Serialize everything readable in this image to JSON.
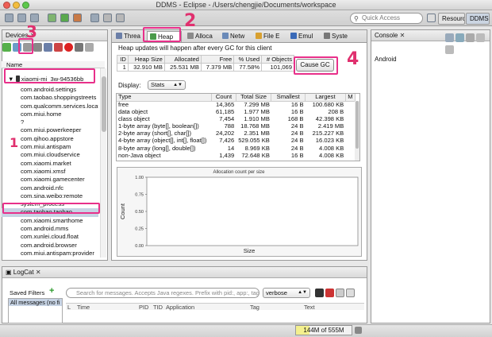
{
  "window": {
    "title": "DDMS - Eclipse - /Users/chengjie/Documents/workspace"
  },
  "toolbar": {
    "quick_access_placeholder": "Quick Access",
    "perspective_resource": "Resource",
    "perspective_ddms": "DDMS"
  },
  "devices": {
    "title": "Devices",
    "name_header": "Name",
    "device": "xiaomi-mi_3w-94536bb",
    "processes": [
      "com.android.settings",
      "com.taobao.shoppingstreets",
      "com.qualcomm.services.locat",
      "com.miui.home",
      "?",
      "com.miui.powerkeeper",
      "com.qihoo.appstore",
      "com.miui.antispam",
      "com.miui.cloudservice",
      "com.xiaomi.market",
      "com.xiaomi.xmsf",
      "com.xiaomi.gamecenter",
      "com.android.nfc",
      "com.sina.weibo:remote",
      "system_process",
      "com.taobao.taobao",
      "com.xiaomi.smarthome",
      "com.android.mms",
      "com.xunlei.cloud.float",
      "com.android.browser",
      "com.miui.antispam:provider"
    ],
    "selected_index": 15
  },
  "tabs": [
    "Threa",
    "Heap",
    "Alloca",
    "Netw",
    "File E",
    "Emul",
    "Syste"
  ],
  "heap": {
    "message": "Heap updates will happen after every GC for this client",
    "summary_headers": [
      "ID",
      "Heap Size",
      "Allocated",
      "Free",
      "% Used",
      "# Objects"
    ],
    "summary_row": [
      "1",
      "32.910 MB",
      "25.531 MB",
      "7.379 MB",
      "77.58%",
      "101,069"
    ],
    "cause_gc": "Cause GC",
    "display_label": "Display:",
    "display_value": "Stats",
    "stats_headers": [
      "Type",
      "Count",
      "Total Size",
      "Smallest",
      "Largest",
      "M"
    ],
    "stats_rows": [
      [
        "free",
        "14,365",
        "7.299 MB",
        "16 B",
        "100.680 KB"
      ],
      [
        "data object",
        "61,185",
        "1.977 MB",
        "16 B",
        "208 B"
      ],
      [
        "class object",
        "7,454",
        "1.910 MB",
        "168 B",
        "42.398 KB"
      ],
      [
        "1-byte array (byte[], boolean[])",
        "788",
        "18.768 MB",
        "24 B",
        "2.419 MB"
      ],
      [
        "2-byte array (short[], char[])",
        "24,202",
        "2.351 MB",
        "24 B",
        "215.227 KB"
      ],
      [
        "4-byte array (object[], int[], float[])",
        "7,426",
        "529.055 KB",
        "24 B",
        "16.023 KB"
      ],
      [
        "8-byte array (long[], double[])",
        "14",
        "8.969 KB",
        "24 B",
        "4.008 KB"
      ],
      [
        "non-Java object",
        "1,439",
        "72.648 KB",
        "16 B",
        "4.008 KB"
      ]
    ]
  },
  "chart_data": {
    "type": "bar",
    "title": "Allocation count per size",
    "xlabel": "Size",
    "ylabel": "Count",
    "ylim": [
      0,
      1.0
    ],
    "yticks": [
      "0.00",
      "0.25",
      "0.50",
      "0.75",
      "1.00"
    ],
    "categories": [],
    "values": []
  },
  "console": {
    "title": "Console",
    "device": "Android"
  },
  "logcat": {
    "title": "LogCat",
    "saved_filters": "Saved Filters",
    "all_messages": "All messages (no fi",
    "search_placeholder": "Search for messages. Accepts Java regexes. Prefix with pid:, app:, tag:",
    "level": "verbose",
    "columns": [
      "L",
      "Time",
      "PID",
      "TID",
      "Application",
      "Tag",
      "Text"
    ]
  },
  "status": {
    "heap_usage": "144M of 555M",
    "used_fraction": 0.26
  },
  "annotations": [
    "1",
    "2",
    "3",
    "4"
  ],
  "colors": {
    "annotation": "#e8308a",
    "selection": "#c6d3e4"
  }
}
